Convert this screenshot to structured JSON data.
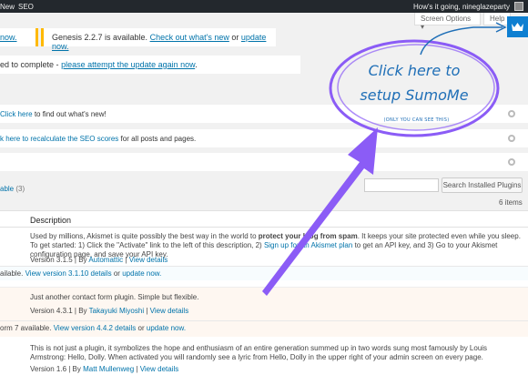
{
  "adminbar": {
    "new_label": "New",
    "seo_label": "SEO",
    "howdy": "How's it going, nineglazeparty"
  },
  "tabs": {
    "screen_options": "Screen Options",
    "help": "Help"
  },
  "notices": {
    "n1_link": "now.",
    "n2_text": "Genesis 2.2.7 is available.",
    "n2_link1": "Check out what's new",
    "n2_or": "or",
    "n2_link2": "update now.",
    "n3_text": "ed to complete -",
    "n3_link": "please attempt the update again now",
    "n3_end": "."
  },
  "row_notices": {
    "r1_link": "Click here",
    "r1_text": "to find out what's new!",
    "r2_link": "k here to recalculate the SEO scores",
    "r2_text": "for all posts and pages."
  },
  "filter": {
    "label": "able",
    "count": "(3)",
    "search_button": "Search Installed Plugins",
    "items": "6 items"
  },
  "table": {
    "header_description": "Description",
    "rows": [
      {
        "desc1_a": "Used by millions, Akismet is quite possibly the best way in the world to",
        "desc1_b": "protect your blog from spam",
        "desc1_c": ". It keeps your site protected even while you sleep. To get started: 1)",
        "desc2_a": "Click the \"Activate\" link to the left of this description, 2)",
        "desc2_link": "Sign up for an Akismet plan",
        "desc2_b": "to get an API key, and 3) Go to your Akismet configuration page, and save your API key.",
        "version": "Version 3.1.5 | By",
        "author": "Automattic",
        "sep": "|",
        "details": "View details",
        "update_a": "ailable.",
        "update_link1": "View version 3.1.10 details",
        "update_or": "or",
        "update_link2": "update now."
      },
      {
        "desc1_a": "Just another contact form plugin. Simple but flexible.",
        "version": "Version 4.3.1 | By",
        "author": "Takayuki Miyoshi",
        "sep": "|",
        "details": "View details",
        "update_a": "orm 7 available.",
        "update_link1": "View version 4.4.2 details",
        "update_or": "or",
        "update_link2": "update now."
      },
      {
        "desc1_a": "This is not just a plugin, it symbolizes the hope and enthusiasm of an entire generation summed up in two words sung most famously by Louis Armstrong: Hello, Dolly.",
        "desc2_a": "When activated you will randomly see a lyric from Hello, Dolly in the upper right of your admin screen on every page.",
        "version": "Version 1.6 | By",
        "author": "Matt Mullenweg",
        "sep": "|",
        "details": "View details"
      }
    ]
  },
  "overlay": {
    "line1": "Click here to",
    "line2": "setup SumoMe",
    "line3": "(ONLY YOU CAN SEE THIS)",
    "colors": {
      "circle": "#8b5cf6",
      "arrow": "#8b5cf6",
      "sumome_blue": "#0e7fd1"
    }
  }
}
